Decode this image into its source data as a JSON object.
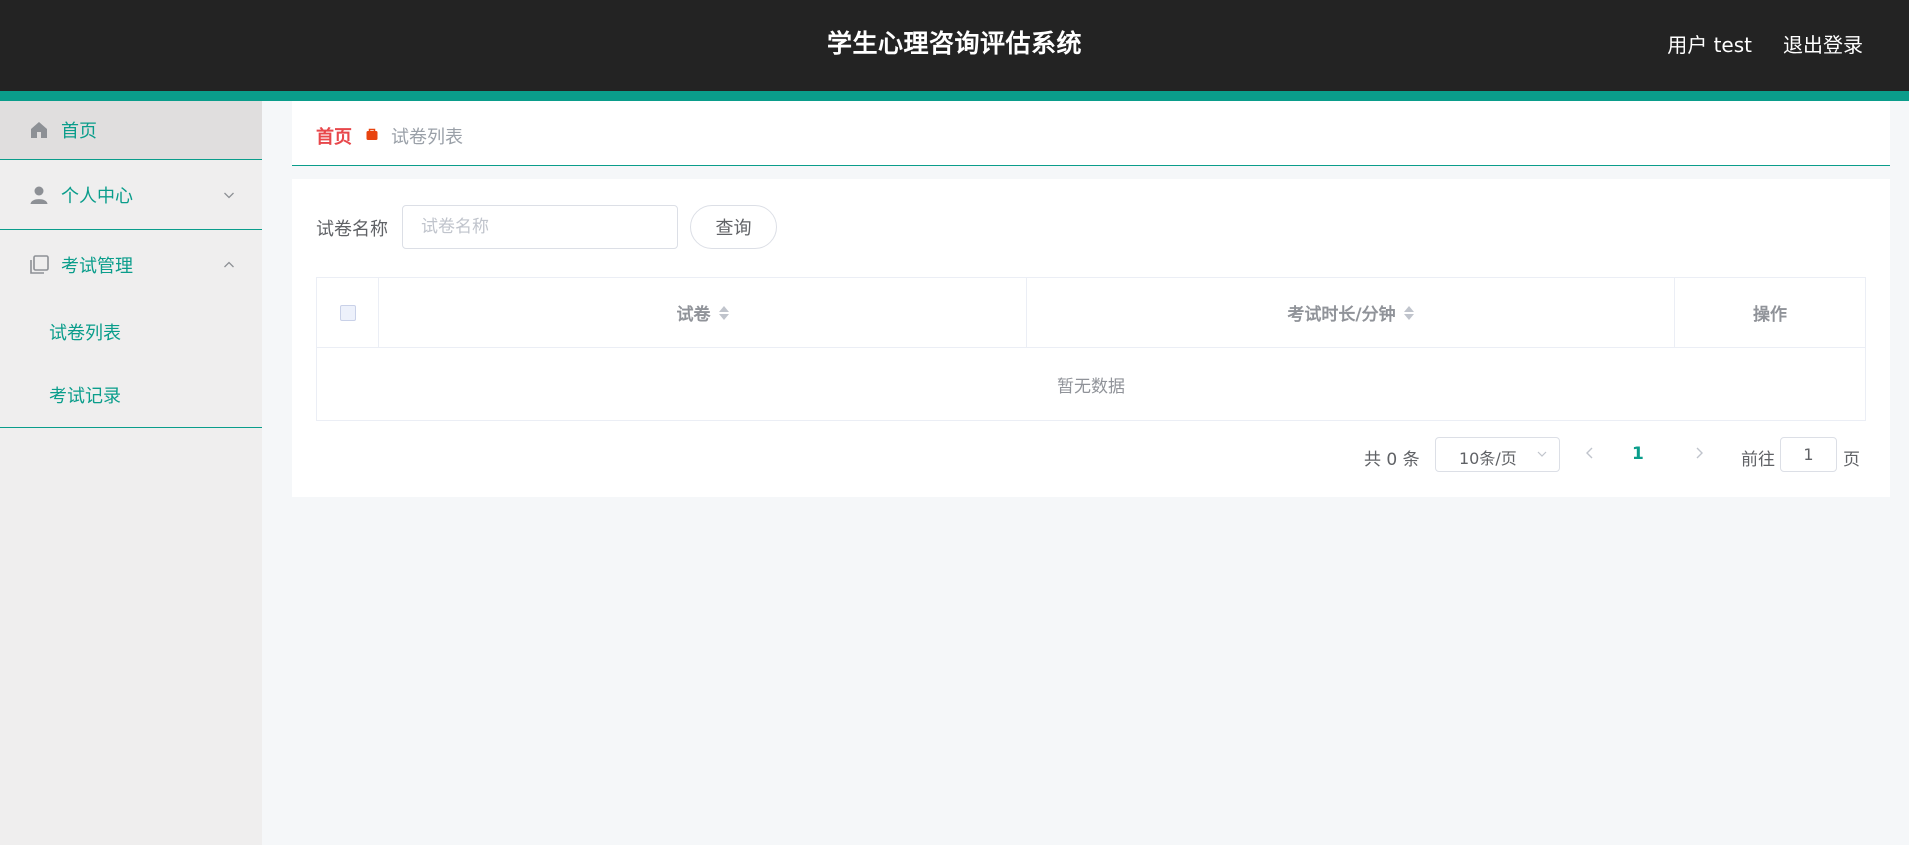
{
  "header": {
    "title": "学生心理咨询评估系统",
    "user": "用户 test",
    "logout": "退出登录"
  },
  "sidebar": {
    "items": [
      {
        "label": "首页",
        "icon": "home-icon"
      },
      {
        "label": "个人中心",
        "icon": "user-icon",
        "expanded": false
      },
      {
        "label": "考试管理",
        "icon": "copy-icon",
        "expanded": true,
        "children": [
          {
            "label": "试卷列表"
          },
          {
            "label": "考试记录"
          }
        ]
      }
    ]
  },
  "breadcrumb": {
    "home": "首页",
    "current": "试卷列表"
  },
  "search": {
    "label": "试卷名称",
    "placeholder": "试卷名称",
    "value": "",
    "button": "查询"
  },
  "table": {
    "columns": [
      "试卷",
      "考试时长/分钟",
      "操作"
    ],
    "empty_text": "暂无数据"
  },
  "pagination": {
    "total": "共 0 条",
    "page_size": "10条/页",
    "current_page": "1",
    "goto_label": "前往",
    "goto_value": "1",
    "page_suffix": "页"
  },
  "colors": {
    "accent": "#0a9d8b",
    "header_bg": "#232323",
    "breadcrumb_home": "#e8474b",
    "breadcrumb_sep": "#e8430f"
  }
}
